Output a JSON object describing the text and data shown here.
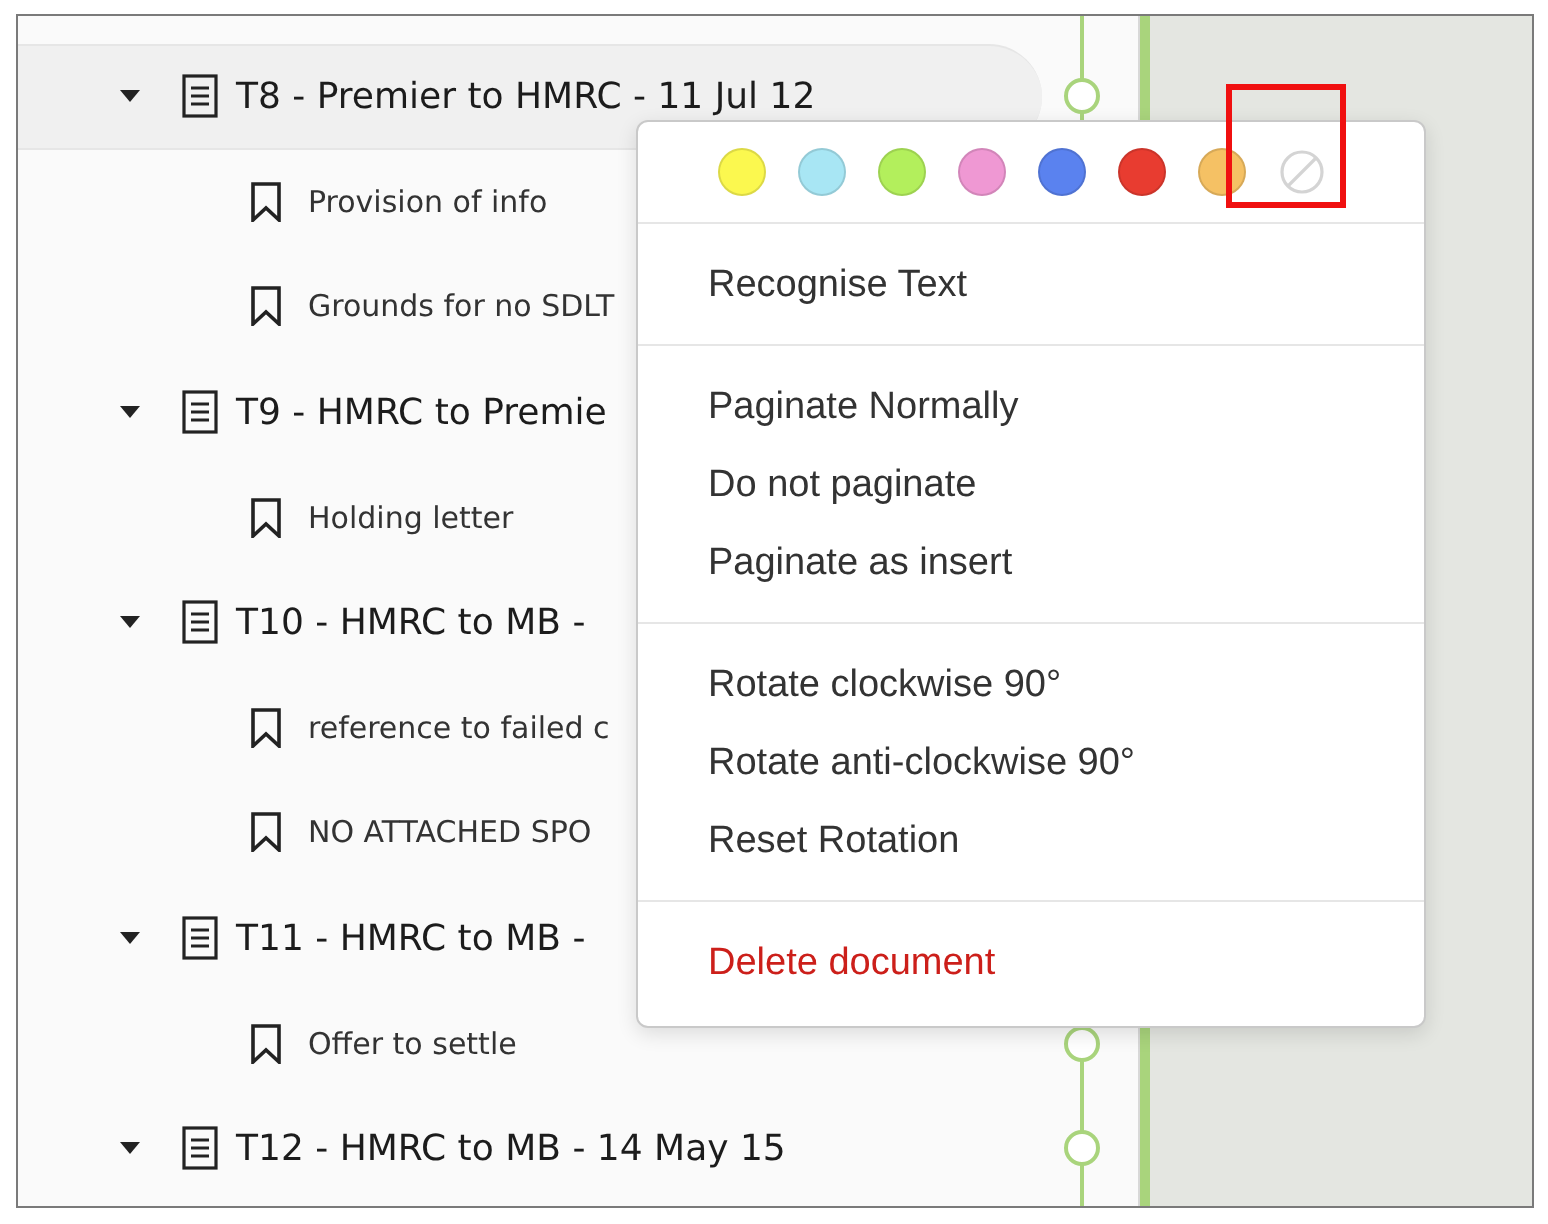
{
  "outline": [
    {
      "kind": "document",
      "label": "T8 - Premier to HMRC - 11 Jul 12",
      "expanded": true,
      "selected": true,
      "children": [
        {
          "kind": "bookmark",
          "label": "Provision of info"
        },
        {
          "kind": "bookmark",
          "label": "Grounds for no SDLT"
        }
      ]
    },
    {
      "kind": "document",
      "label": "T9 - HMRC to Premie",
      "expanded": true,
      "selected": false,
      "children": [
        {
          "kind": "bookmark",
          "label": "Holding letter"
        }
      ]
    },
    {
      "kind": "document",
      "label": "T10 - HMRC to MB -",
      "expanded": true,
      "selected": false,
      "children": [
        {
          "kind": "bookmark",
          "label": "reference to failed c"
        },
        {
          "kind": "bookmark",
          "label": "NO ATTACHED SPO"
        }
      ]
    },
    {
      "kind": "document",
      "label": "T11 - HMRC to MB -",
      "expanded": true,
      "selected": false,
      "children": [
        {
          "kind": "bookmark",
          "label": "Offer to settle"
        }
      ]
    },
    {
      "kind": "document",
      "label": "T12 - HMRC to MB - 14 May 15",
      "expanded": true,
      "selected": false
    }
  ],
  "context_menu": {
    "swatches": [
      {
        "kind": "color",
        "color": "#fbf84f",
        "outlined": false
      },
      {
        "kind": "color",
        "color": "#a8e6f4",
        "outlined": false
      },
      {
        "kind": "color",
        "color": "#b3ef5c",
        "outlined": false
      },
      {
        "kind": "color",
        "color": "#ef98d3",
        "outlined": false
      },
      {
        "kind": "color",
        "color": "#5a82ef",
        "outlined": false
      },
      {
        "kind": "color",
        "color": "#e83c30",
        "outlined": false
      },
      {
        "kind": "color",
        "color": "#f5c164",
        "outlined": false
      },
      {
        "kind": "none",
        "outlined": true
      }
    ],
    "groups": [
      [
        {
          "label": "Recognise Text",
          "kind": "normal"
        }
      ],
      [
        {
          "label": "Paginate Normally",
          "kind": "normal"
        },
        {
          "label": "Do not paginate",
          "kind": "normal"
        },
        {
          "label": "Paginate as insert",
          "kind": "normal"
        }
      ],
      [
        {
          "label": "Rotate clockwise 90°",
          "kind": "normal"
        },
        {
          "label": "Rotate anti-clockwise 90°",
          "kind": "normal"
        },
        {
          "label": "Reset Rotation",
          "kind": "normal"
        }
      ],
      [
        {
          "label": "Delete document",
          "kind": "destructive"
        }
      ]
    ]
  }
}
